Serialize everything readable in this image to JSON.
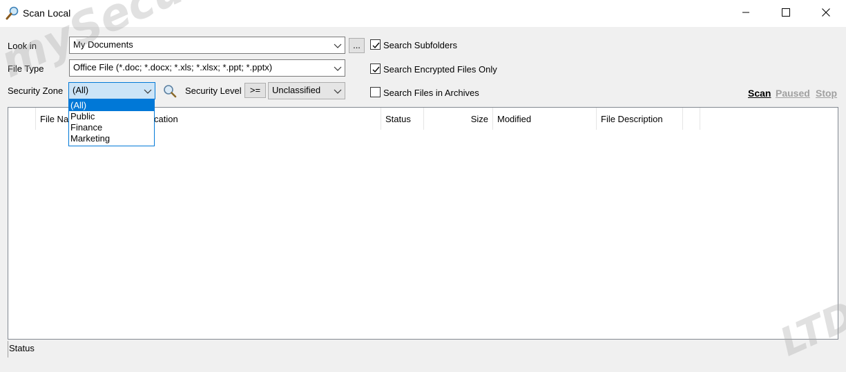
{
  "window": {
    "title": "Scan Local",
    "minimize_icon": "minimize-icon",
    "maximize_icon": "maximize-icon",
    "close_icon": "close-icon"
  },
  "form": {
    "look_in_label": "Look in",
    "look_in_value": "My Documents",
    "browse_label": "...",
    "file_type_label": "File Type",
    "file_type_value": "Office File (*.doc; *.docx; *.xls; *.xlsx; *.ppt; *.pptx)",
    "security_zone_label": "Security Zone",
    "security_zone_value": "(All)",
    "security_level_label": "Security Level",
    "level_operator": ">=",
    "security_level_value": "Unclassified"
  },
  "options": {
    "search_subfolders": {
      "label": "Search Subfolders",
      "checked": true
    },
    "search_encrypted": {
      "label": "Search Encrypted Files Only",
      "checked": true
    },
    "search_archives": {
      "label": "Search Files in Archives",
      "checked": false
    }
  },
  "actions": {
    "scan": "Scan",
    "paused": "Paused",
    "stop": "Stop",
    "active_color": "#000000",
    "disabled_color": "#a0a0a0"
  },
  "zone_dropdown": {
    "options": [
      "(All)",
      "Public",
      "Finance",
      "Marketing"
    ],
    "selected": "(All)"
  },
  "table": {
    "columns": [
      "File Na",
      "cation",
      "Status",
      "Size",
      "Modified",
      "File Description"
    ]
  },
  "status_bar": {
    "text": "Status"
  },
  "watermark": {
    "text_1": "mySecura SOFTW",
    "text_2": "LTD"
  }
}
